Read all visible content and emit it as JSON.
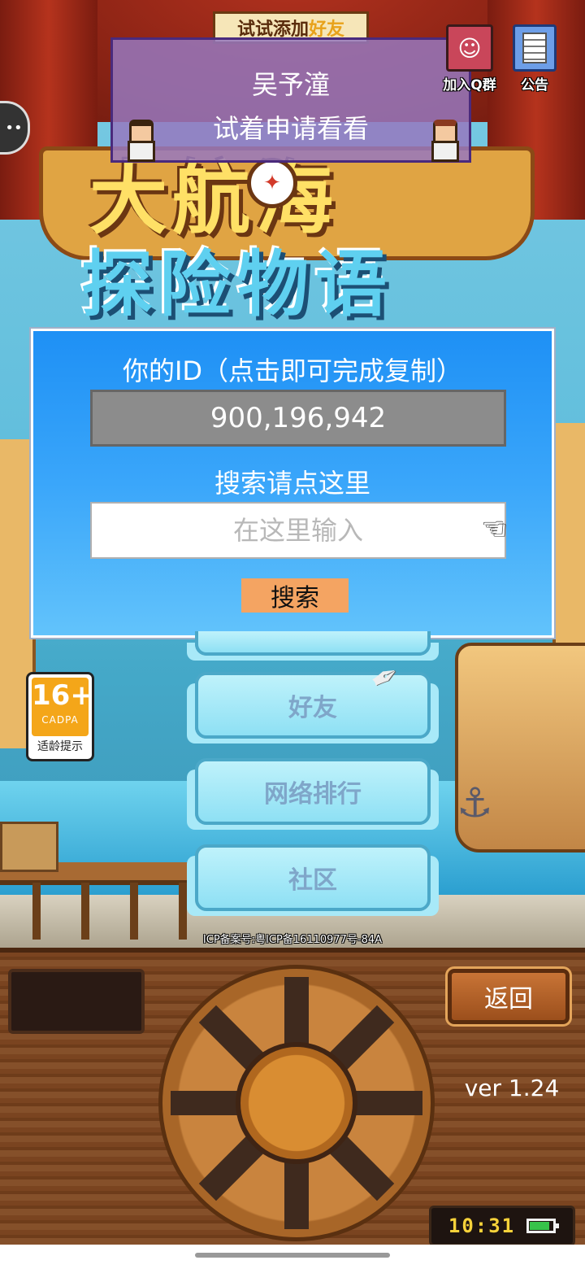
{
  "banner": {
    "text_prefix": "试试添加",
    "text_highlight": "好友"
  },
  "friend_card": {
    "name": "吴予潼",
    "subtitle": "试着申请看看"
  },
  "top_buttons": {
    "qq_group_label": "加入Q群",
    "notice_label": "公告"
  },
  "logo": {
    "line1": "大航海",
    "line2": "探险物语"
  },
  "id_panel": {
    "id_label": "你的ID（点击即可完成复制）",
    "id_value": "900,196,942",
    "search_label": "搜索请点这里",
    "search_placeholder": "在这里输入",
    "search_button": "搜索"
  },
  "menu": {
    "friends": "好友",
    "ranking": "网络排行",
    "community": "社区"
  },
  "age_rating": {
    "age": "16+",
    "org": "CADPA",
    "tip": "适龄提示"
  },
  "icp": "ICP备案号:粤ICP备16110977号-84A",
  "console": {
    "back_label": "返回",
    "version": "ver 1.24",
    "time": "10:31",
    "battery_level": 0.8
  },
  "icons": {
    "hand": "pointing-hand-icon",
    "compass": "compass-icon",
    "anchor": "anchor-icon",
    "feather": "quill-icon"
  },
  "colors": {
    "panel_blue": "#1e90f5",
    "search_button": "#f4a462",
    "id_box": "#8c8c8c",
    "clock": "#f7d23a",
    "battery": "#37c34a"
  }
}
